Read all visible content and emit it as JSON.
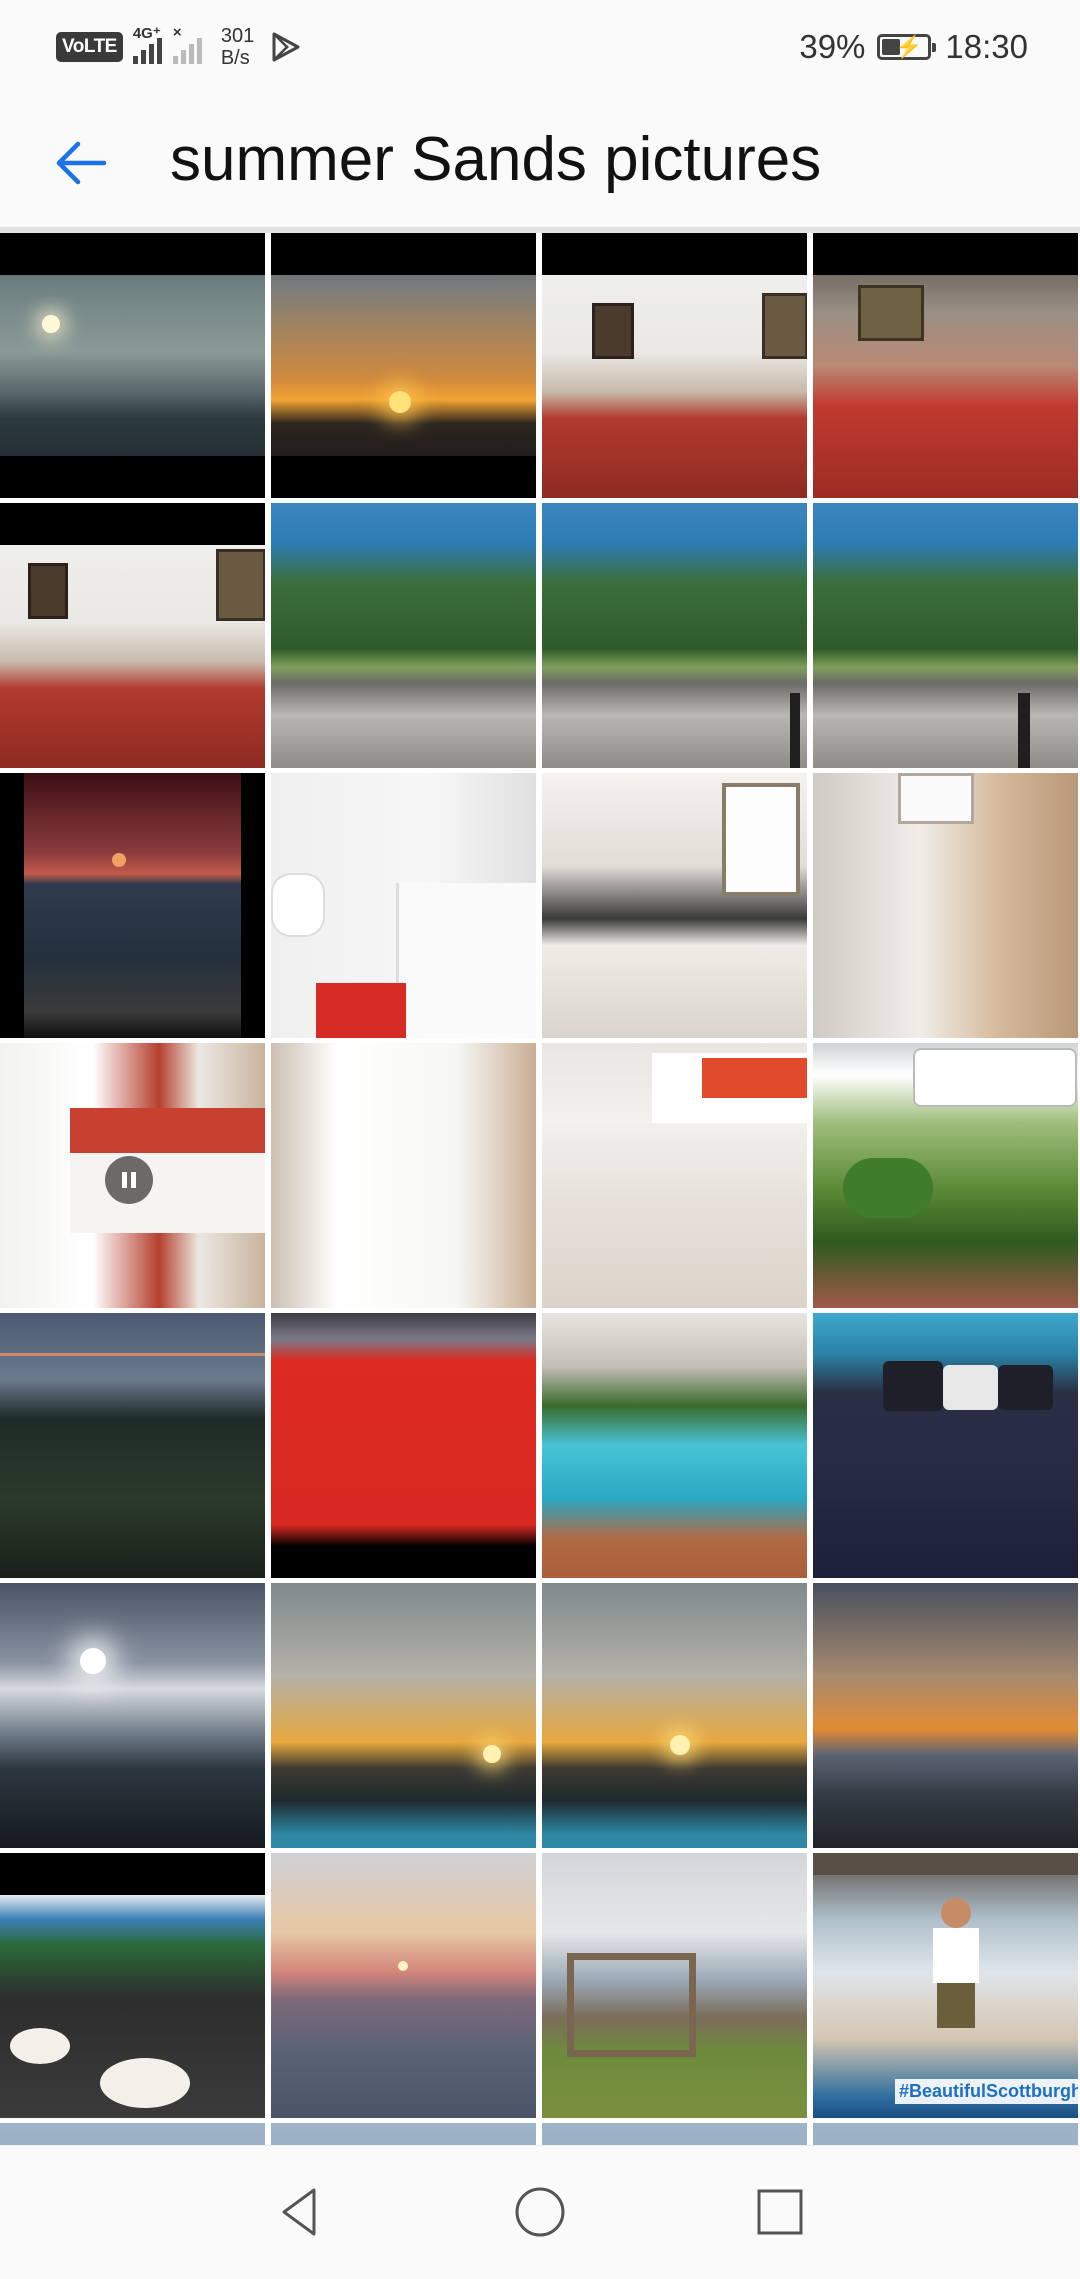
{
  "status_bar": {
    "volte": "VoLTE",
    "network": "4G⁺",
    "speed_value": "301",
    "speed_unit": "B/s",
    "battery_text": "39%",
    "battery_level": 0.39,
    "time": "18:30"
  },
  "app_bar": {
    "title": "summer Sands pictures",
    "back_icon": "arrow-left-icon",
    "accent": "#1a73e8"
  },
  "grid": {
    "overlay_text": "#BeautifulScottburgh",
    "pause_icon": "pause-icon"
  },
  "nav": {
    "back_icon": "triangle-back-icon",
    "home_icon": "circle-home-icon",
    "recents_icon": "square-recents-icon"
  }
}
